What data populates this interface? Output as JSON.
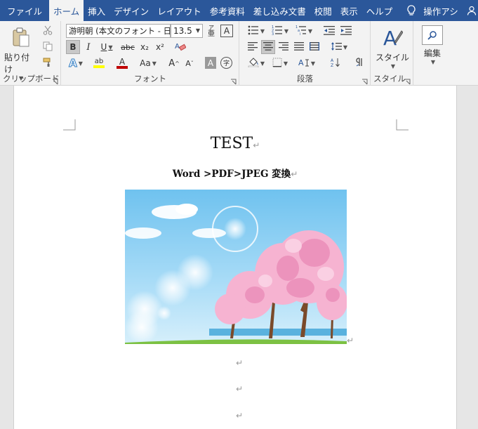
{
  "tabs": [
    {
      "label": "ファイル",
      "active": false
    },
    {
      "label": "ホーム",
      "active": true
    },
    {
      "label": "挿入",
      "active": false
    },
    {
      "label": "デザイン",
      "active": false
    },
    {
      "label": "レイアウト",
      "active": false
    },
    {
      "label": "参考資料",
      "active": false
    },
    {
      "label": "差し込み文書",
      "active": false
    },
    {
      "label": "校閲",
      "active": false
    },
    {
      "label": "表示",
      "active": false
    },
    {
      "label": "ヘルプ",
      "active": false
    }
  ],
  "tellme": {
    "label": "操作アシ",
    "icon": "lightbulb-icon"
  },
  "share": {
    "label": "共有",
    "icon": "person-icon"
  },
  "ribbon": {
    "clipboard": {
      "label": "クリップボード",
      "paste_label": "貼り付け"
    },
    "font": {
      "label": "フォント",
      "font_name": "游明朝 (本文のフォント - 日",
      "font_size": "13.5",
      "furigana": "亜",
      "bold": "B",
      "italic": "I",
      "underline": "U",
      "strike": "abc",
      "subscript": "x₂",
      "superscript": "x²",
      "font_color_letter": "A",
      "highlight_letter": "ab",
      "grow": "A",
      "shrink": "A",
      "change_case": "Aa",
      "char_shading": "A",
      "enclose": "字",
      "text_effect": "A",
      "box_letter": "A",
      "font_color_hex": "#c00000",
      "highlight_hex": "#ffff00"
    },
    "paragraph": {
      "label": "段落"
    },
    "style": {
      "label": "スタイル",
      "button_label": "スタイル"
    },
    "edit": {
      "label": "編集"
    }
  },
  "document": {
    "title": "TEST",
    "subtitle": "Word >PDF>JPEG 変換",
    "pilcrow": "↵"
  },
  "colors": {
    "titlebar": "#2b579a",
    "ribbon_bg": "#f3f3f3",
    "page_bg": "#ffffff",
    "canvas_bg": "#e6e6e6"
  }
}
